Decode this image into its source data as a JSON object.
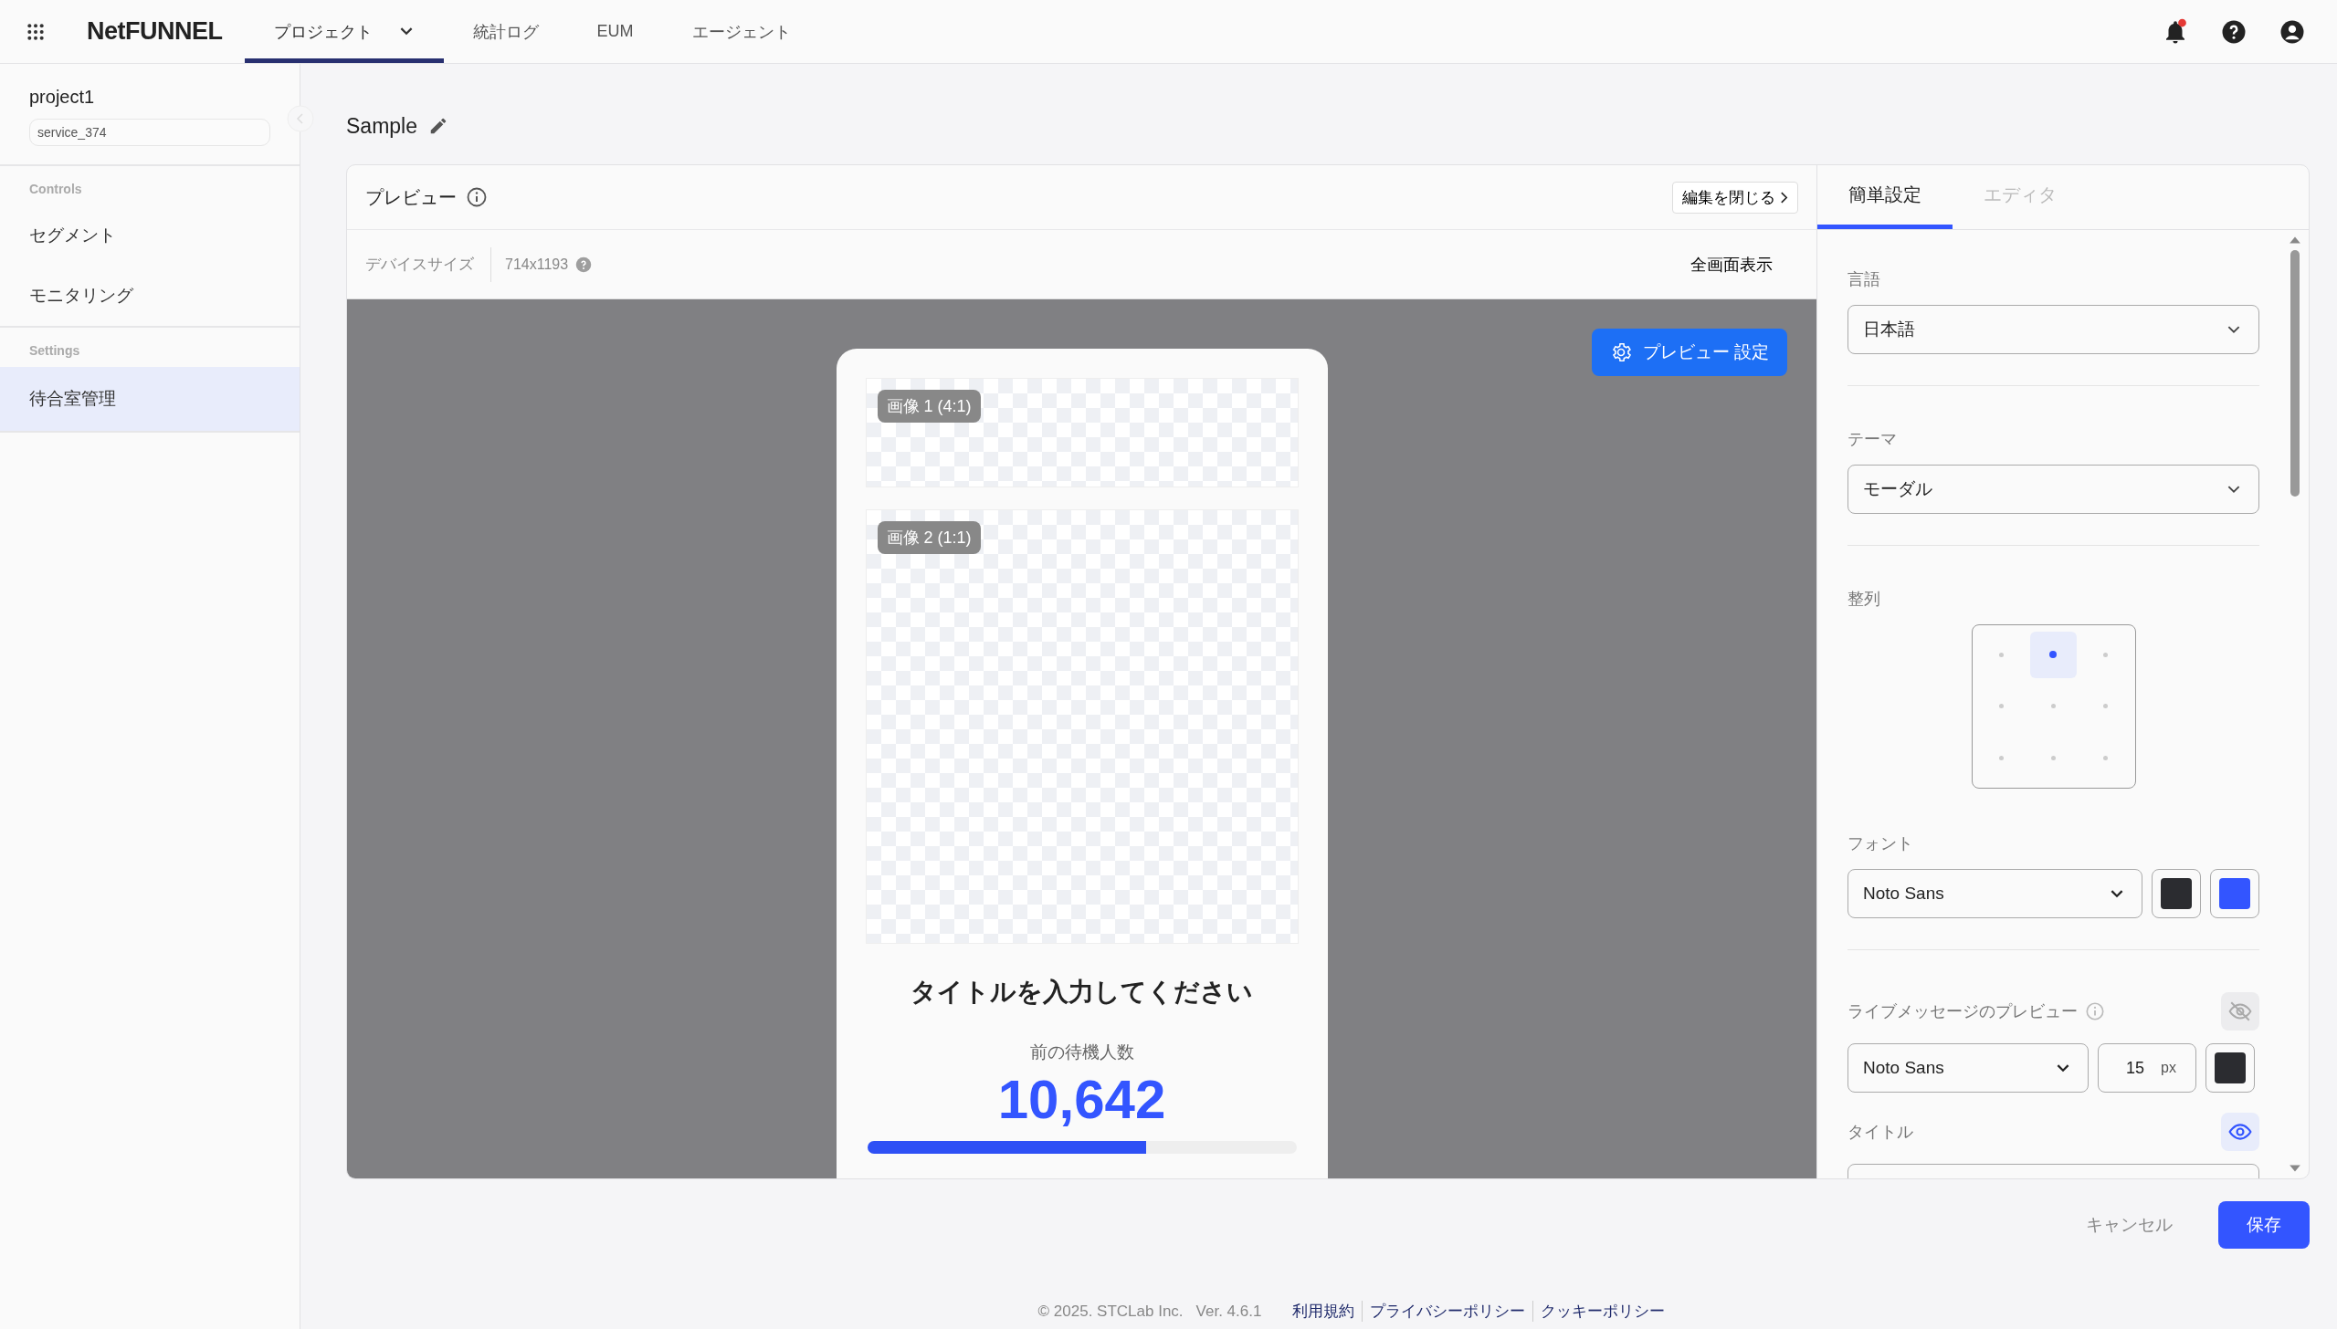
{
  "app": {
    "logo": "NetFUNNEL"
  },
  "nav_tabs": [
    {
      "label": "プロジェクト",
      "selected": true,
      "dropdown": true
    },
    {
      "label": "統計ログ",
      "selected": false,
      "dropdown": false
    },
    {
      "label": "EUM",
      "selected": false,
      "dropdown": false
    },
    {
      "label": "エージェント",
      "selected": false,
      "dropdown": false
    }
  ],
  "notifications": {
    "unread": true
  },
  "sidebar": {
    "project": "project1",
    "service": "service_374",
    "sections": [
      {
        "heading": "Controls",
        "items": [
          {
            "label": "セグメント",
            "selected": false
          },
          {
            "label": "モニタリング",
            "selected": false
          }
        ]
      },
      {
        "heading": "Settings",
        "items": [
          {
            "label": "待合室管理",
            "selected": true
          }
        ]
      }
    ]
  },
  "page": {
    "title": "Sample"
  },
  "preview": {
    "title": "プレビュー",
    "close_button": "編集を閉じる",
    "device_label": "デバイスサイズ",
    "device_size": "714x1193",
    "fullscreen": "全画面表示",
    "settings_button": "プレビュー 設定",
    "images": [
      {
        "label": "画像 1 (4:1)",
        "kind": "wide"
      },
      {
        "label": "画像 2 (1:1)",
        "kind": "square"
      }
    ],
    "heading": "タイトルを入力してください",
    "queue_label": "前の待機人数",
    "queue_count": "10,642",
    "progress": {
      "level": 0.65
    }
  },
  "settings_tabs": [
    {
      "label": "簡単設定",
      "selected": true
    },
    {
      "label": "エディタ",
      "selected": false
    }
  ],
  "settings": {
    "language": {
      "label": "言語",
      "value": "日本語"
    },
    "theme": {
      "label": "テーマ",
      "value": "モーダル"
    },
    "alignment": {
      "label": "整列",
      "cells": [
        {
          "selected": false
        },
        {
          "selected": true
        },
        {
          "selected": false
        },
        {
          "selected": false
        },
        {
          "selected": false
        },
        {
          "selected": false
        },
        {
          "selected": false
        },
        {
          "selected": false
        },
        {
          "selected": false
        }
      ]
    },
    "font": {
      "label": "フォント",
      "value": "Noto Sans",
      "swatches": [
        {
          "color": "#2b2c30"
        },
        {
          "color": "#3355ff"
        }
      ]
    },
    "live_message": {
      "label": "ライブメッセージのプレビュー",
      "visible": false,
      "font": "Noto Sans",
      "size": "15",
      "unit": "px",
      "color": "#2b2c30"
    },
    "title": {
      "label": "タイトル",
      "visible": true
    }
  },
  "actions": {
    "cancel": "キャンセル",
    "save": "保存"
  },
  "footer": {
    "copyright": "© 2025. STCLab Inc.",
    "version": "Ver. 4.6.1",
    "links": [
      "利用規約",
      "プライバシーポリシー",
      "クッキーポリシー"
    ]
  }
}
